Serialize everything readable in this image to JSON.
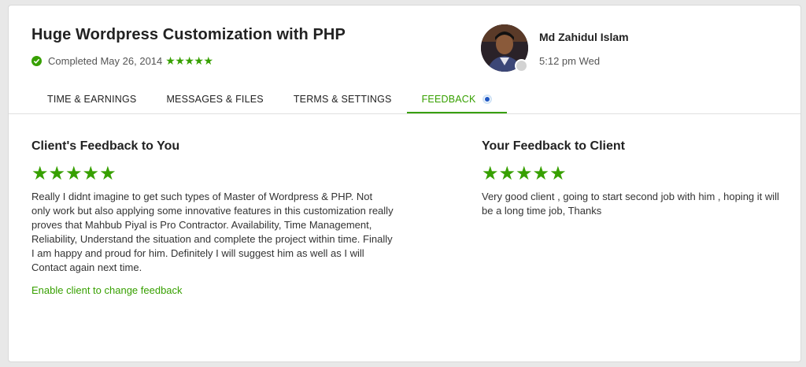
{
  "contract": {
    "title": "Huge Wordpress Customization with PHP",
    "status_text": "Completed May 26, 2014",
    "rating_stars": "★★★★★",
    "rating": 5
  },
  "user": {
    "name": "Md Zahidul Islam",
    "local_time": "5:12 pm Wed"
  },
  "tabs": [
    {
      "label": "TIME & EARNINGS"
    },
    {
      "label": "MESSAGES & FILES"
    },
    {
      "label": "TERMS & SETTINGS"
    },
    {
      "label": "FEEDBACK"
    }
  ],
  "active_tab": "FEEDBACK",
  "client_feedback": {
    "heading": "Client's Feedback to You",
    "stars": "★★★★★",
    "rating": 5,
    "text": "Really I didnt imagine to get such types of Master of Wordpress & PHP. Not only work but also applying some innovative features in this customization really proves that Mahbub Piyal is Pro Contractor. Availability, Time Management, Reliability, Understand the situation and complete the project within time. Finally I am happy and proud for him. Definitely I will suggest him as well as I will Contact again next time.",
    "link_label": "Enable client to change feedback"
  },
  "your_feedback": {
    "heading": "Your Feedback to Client",
    "stars": "★★★★★",
    "rating": 5,
    "text": "Very good client , going to start second job with him , hoping it will be a long time job, Thanks"
  },
  "colors": {
    "accent": "#37a000",
    "dot": "#1f57c3"
  },
  "icons": [
    "check-circle-icon",
    "star-icon",
    "avatar",
    "presence-dot-icon"
  ]
}
